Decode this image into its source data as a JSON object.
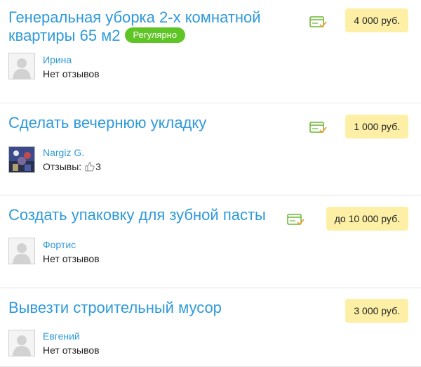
{
  "tasks": [
    {
      "title": "Генеральная уборка 2-х комнатной квартиры 65 м2",
      "badge": "Регулярно",
      "price": "4 000 руб.",
      "user": {
        "name": "Ирина",
        "reviews": "Нет отзывов"
      },
      "icons": [
        "payment-card-check-icon",
        "avatar-placeholder-icon"
      ]
    },
    {
      "title": "Сделать вечернюю укладку",
      "price": "1 000 руб.",
      "user": {
        "name": "Nargiz G.",
        "reviews_label": "Отзывы:",
        "reviews_count": "3"
      },
      "icons": [
        "payment-card-check-icon",
        "user-photo-avatar",
        "thumbs-up-icon"
      ]
    },
    {
      "title": "Создать упаковку для зубной пасты",
      "price": "до 10 000 руб.",
      "user": {
        "name": "Фортис",
        "reviews": "Нет отзывов"
      },
      "icons": [
        "payment-card-check-icon",
        "avatar-placeholder-icon"
      ]
    },
    {
      "title": "Вывезти строительный мусор",
      "price": "3 000 руб.",
      "user": {
        "name": "Евгений",
        "reviews": "Нет отзывов"
      },
      "icons": [
        "avatar-placeholder-icon"
      ]
    }
  ],
  "colors": {
    "link": "#2f9ad9",
    "badge": "#5fc526",
    "price_bg": "#fdf0a6",
    "card_icon": "#6ab531"
  }
}
